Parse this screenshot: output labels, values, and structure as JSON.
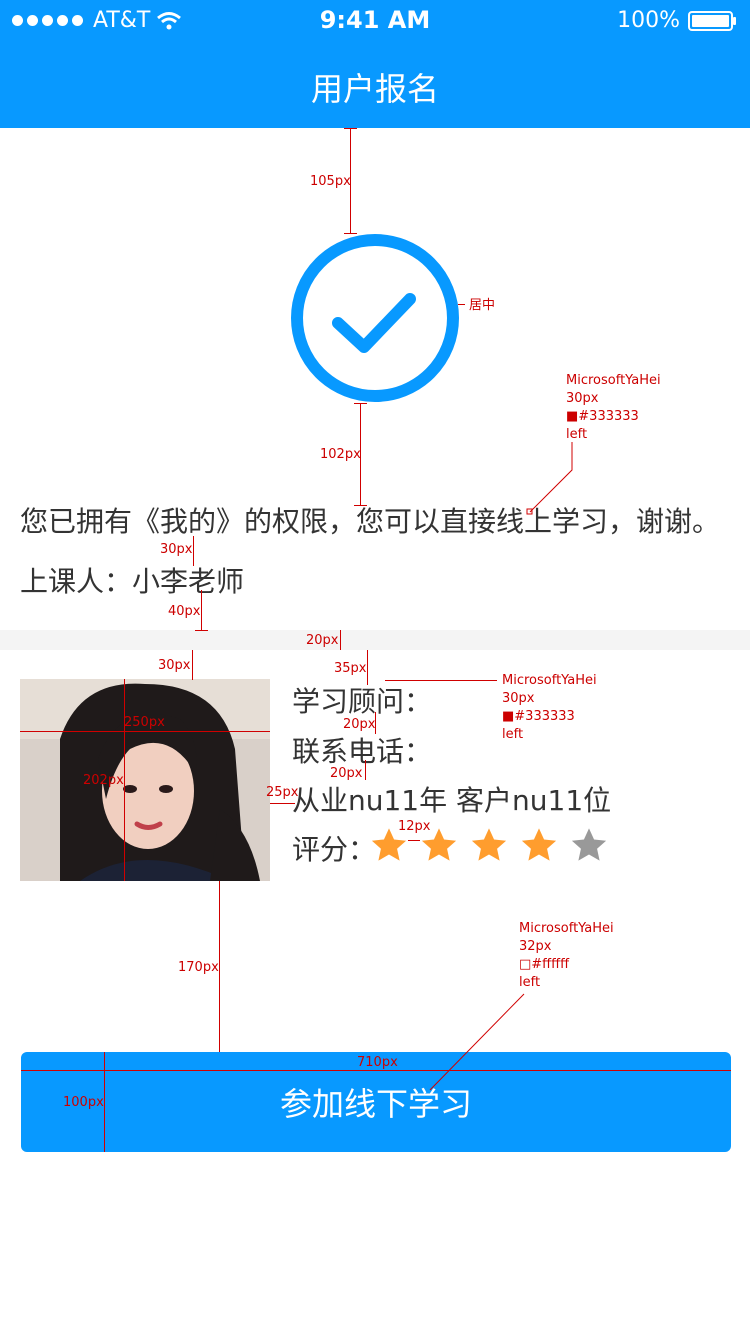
{
  "status_bar": {
    "carrier": "AT&T",
    "time": "9:41 AM",
    "battery": "100%"
  },
  "nav": {
    "title": "用户报名"
  },
  "success": {
    "message": "您已拥有《我的》的权限，您可以直接线上学习，谢谢。",
    "teacher": "上课人：小李老师"
  },
  "advisor": {
    "advisor_label": "学习顾问：",
    "phone_label": "联系电话：",
    "experience": "从业nu11年   客户nu11位",
    "rating_label": "评分：",
    "rating": 4,
    "rating_max": 5
  },
  "action": {
    "button_label": "参加线下学习"
  },
  "annotations": {
    "a105": "105px",
    "center": "居中",
    "font1": [
      "MicrosoftYaHei",
      "30px",
      "■#333333",
      "left"
    ],
    "a102": "102px",
    "a30a": "30px",
    "a40": "40px",
    "a20a": "20px",
    "a35": "35px",
    "font2": [
      "MicrosoftYaHei",
      "30px",
      "■#333333",
      "left"
    ],
    "a30b": "30px",
    "a250": "250px",
    "a20b": "20px",
    "a202": "202px",
    "a25": "25px",
    "a20c": "20px",
    "a12": "12px",
    "font3": [
      "MicrosoftYaHei",
      "32px",
      "□#ffffff",
      "left"
    ],
    "a170": "170px",
    "a710": "710px",
    "a100": "100px"
  },
  "colors": {
    "primary": "#0899ff",
    "text": "#333333",
    "star_on": "#ff9d2e",
    "star_off": "#999999",
    "annotation": "#cc0000"
  },
  "icons": [
    "signal-dots-icon",
    "wifi-icon",
    "battery-icon",
    "check-circle-icon",
    "star-icon"
  ]
}
